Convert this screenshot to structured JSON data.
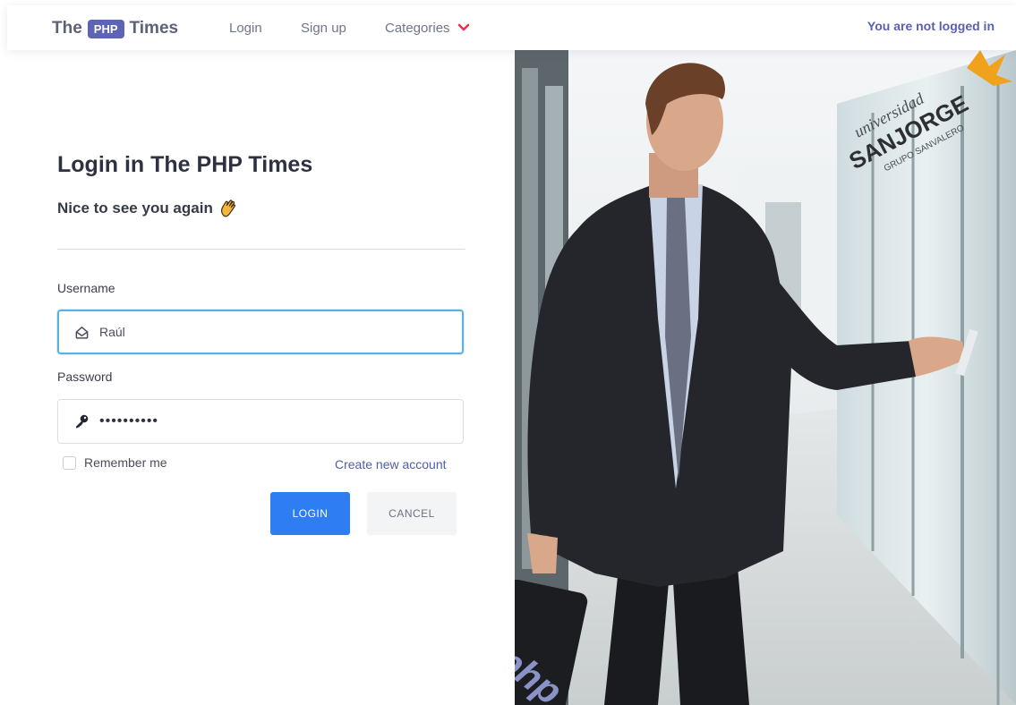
{
  "nav": {
    "brand_pre": "The",
    "brand_badge": "PHP",
    "brand_post": "Times",
    "links": [
      "Login",
      "Sign up",
      "Categories"
    ],
    "status": "You are not logged in"
  },
  "login": {
    "title": "Login in The PHP Times",
    "subtitle": "Nice to see you again",
    "username_label": "Username",
    "username_value": "Raúl",
    "password_label": "Password",
    "password_value": "••••••••••",
    "remember_label": "Remember me",
    "create_account": "Create new account",
    "login_button": "LOGIN",
    "cancel_button": "CANCEL"
  },
  "photo": {
    "sign_line1": "universidad",
    "sign_line2": "SANJORGE",
    "sign_line3": "GRUPO SANVALERO",
    "case_logo": "php"
  },
  "icons": {
    "chevron": "chevron-down-icon",
    "wave": "waving-hand-icon",
    "user": "user-icon",
    "key": "key-icon"
  },
  "colors": {
    "accent": "#2f7df2",
    "brand": "#5d63b5",
    "chevron": "#e8344d",
    "focus": "#5ab1e4"
  }
}
